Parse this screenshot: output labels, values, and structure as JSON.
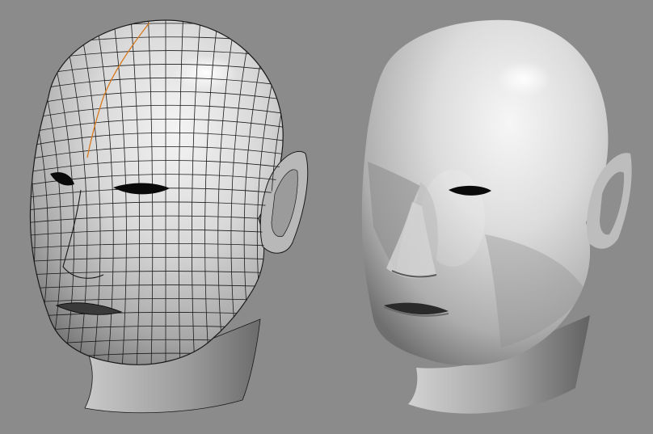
{
  "scene": {
    "background": "#8b8b8b",
    "models": [
      {
        "name": "wireframe-head",
        "shading": "wireframe-over-shaded",
        "wire_color": "#1a1a1a",
        "seam_color": "#d87a1e"
      },
      {
        "name": "smooth-head",
        "shading": "smooth-shaded"
      }
    ]
  }
}
